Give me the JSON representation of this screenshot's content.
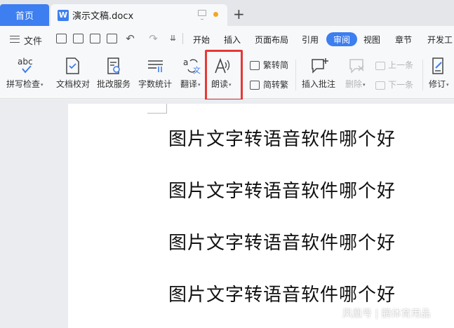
{
  "tabs": {
    "home": "首页",
    "doc_icon": "W",
    "doc_title": "演示文稿.docx",
    "new_tab": "+"
  },
  "menubar": {
    "file": "文件",
    "undo": "↶",
    "redo": "↷",
    "more": "⇊",
    "tabs": [
      "开始",
      "插入",
      "页面布局",
      "引用",
      "审阅",
      "视图",
      "章节",
      "开发工"
    ],
    "active_tab": "审阅"
  },
  "ribbon": {
    "spell_check": "拼写检查",
    "spell_icon_text": "abc",
    "doc_proof": "文档校对",
    "revise_service": "批改服务",
    "word_count": "字数统计",
    "translate": "翻译",
    "read_aloud": "朗读",
    "trad_to_simp": "繁转简",
    "simp_to_trad": "简转繁",
    "insert_comment": "插入批注",
    "delete": "删除",
    "prev": "上一条",
    "next": "下一条",
    "track_changes": "修订",
    "caret": "▾"
  },
  "document": {
    "lines": [
      "图片文字转语音软件哪个好",
      "图片文字转语音软件哪个好",
      "图片文字转语音软件哪个好",
      "图片文字转语音软件哪个好"
    ]
  },
  "watermark": "凤凰号 | 鹏体育用品",
  "colors": {
    "accent": "#3d7ef0",
    "highlight": "#e53935"
  }
}
